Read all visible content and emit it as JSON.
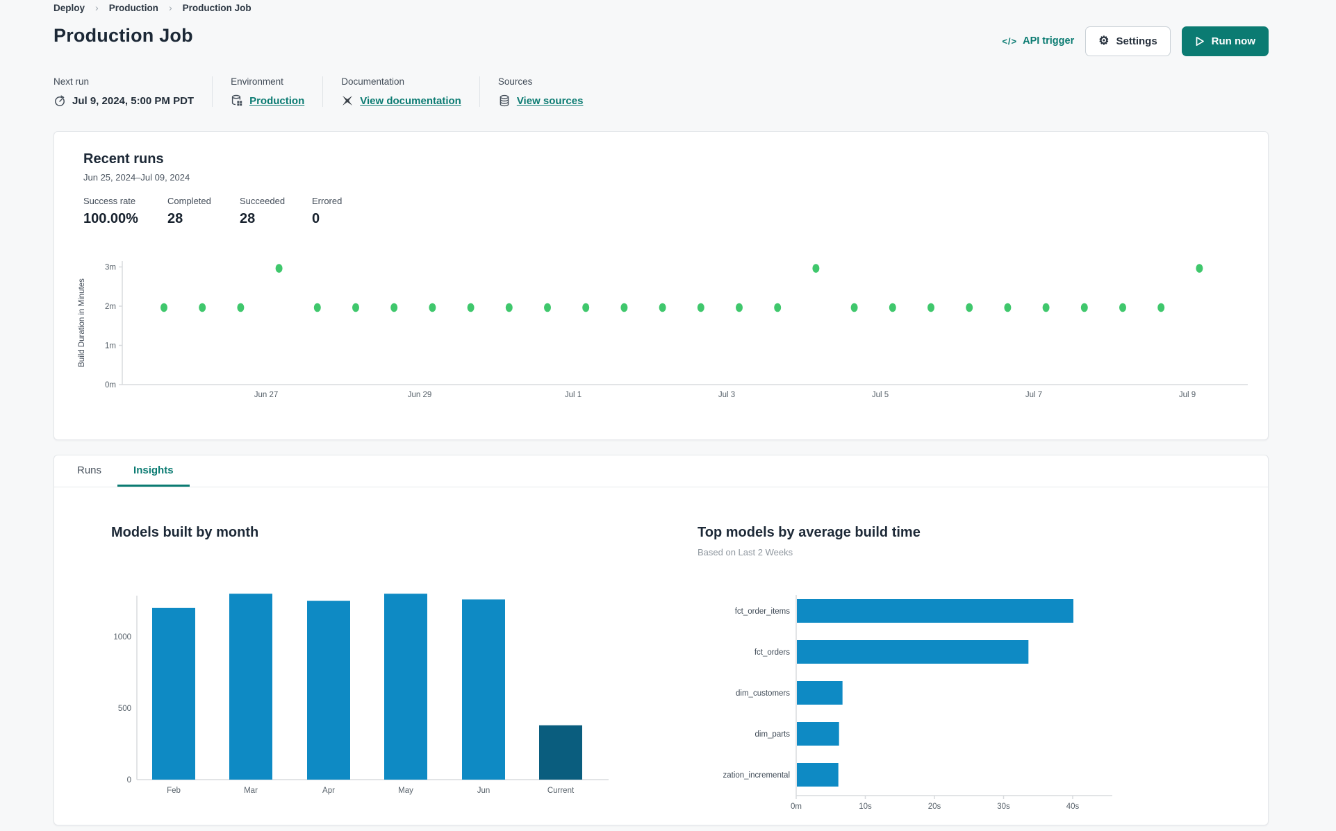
{
  "colors": {
    "accent_teal": "#0b7b72",
    "run_dot_green": "#3fc76c",
    "bar_blue": "#0e8ac4",
    "bar_dark_blue": "#0a5d7e",
    "axis_line": "#d8dbde",
    "tick_text": "#566069"
  },
  "breadcrumb": {
    "items": [
      "Deploy",
      "Production",
      "Production Job"
    ]
  },
  "header": {
    "title": "Production Job",
    "api_trigger_label": "API trigger",
    "settings_label": "Settings",
    "run_now_label": "Run now"
  },
  "info": {
    "next_run": {
      "label": "Next run",
      "value": "Jul 9, 2024, 5:00 PM PDT"
    },
    "environment": {
      "label": "Environment",
      "link": "Production"
    },
    "documentation": {
      "label": "Documentation",
      "link": "View documentation"
    },
    "sources": {
      "label": "Sources",
      "link": "View sources"
    }
  },
  "recent_runs": {
    "title": "Recent runs",
    "date_range": "Jun 25, 2024–Jul 09, 2024",
    "stats": [
      {
        "label": "Success rate",
        "value": "100.00%"
      },
      {
        "label": "Completed",
        "value": "28"
      },
      {
        "label": "Succeeded",
        "value": "28"
      },
      {
        "label": "Errored",
        "value": "0"
      }
    ]
  },
  "tabs": [
    {
      "label": "Runs",
      "active": false
    },
    {
      "label": "Insights",
      "active": true
    }
  ],
  "chart_data": [
    {
      "id": "build-duration-scatter",
      "type": "scatter",
      "ylabel": "Build Duration in Minutes",
      "y_ticks": [
        "0m",
        "1m",
        "2m",
        "3m"
      ],
      "ylim": [
        0,
        3
      ],
      "x_ticks": [
        "Jun 27",
        "Jun 29",
        "Jul 1",
        "Jul 3",
        "Jul 5",
        "Jul 7",
        "Jul 9"
      ],
      "points_minutes": [
        2,
        2,
        2,
        3,
        2,
        2,
        2,
        2,
        2,
        2,
        2,
        2,
        2,
        2,
        2,
        2,
        2,
        3,
        2,
        2,
        2,
        2,
        2,
        2,
        2,
        2,
        2,
        3
      ],
      "point_color": "#3fc76c"
    },
    {
      "id": "models-built-by-month",
      "type": "bar",
      "title": "Models built by month",
      "categories": [
        "Feb",
        "Mar",
        "Apr",
        "May",
        "Jun",
        "Current"
      ],
      "values": [
        1200,
        1300,
        1250,
        1300,
        1260,
        380
      ],
      "y_ticks": [
        0,
        500,
        1000
      ],
      "ylim": [
        0,
        1450
      ],
      "bar_color": "#0e8ac4",
      "current_bar_color": "#0a5d7e",
      "highlight_category": "Current"
    },
    {
      "id": "top-models-by-build-time",
      "type": "horizontal-bar",
      "title": "Top models by average build time",
      "subtitle": "Based on Last 2 Weeks",
      "categories": [
        "fct_order_items",
        "fct_orders",
        "dim_customers",
        "dim_parts",
        "materialization_incremental"
      ],
      "values_seconds": [
        40,
        33.5,
        6.6,
        6.1,
        6.0
      ],
      "x_ticks": [
        "0m",
        "10s",
        "20s",
        "30s",
        "40s"
      ],
      "xlim_seconds": [
        0,
        45
      ],
      "bar_color": "#0e8ac4"
    }
  ]
}
